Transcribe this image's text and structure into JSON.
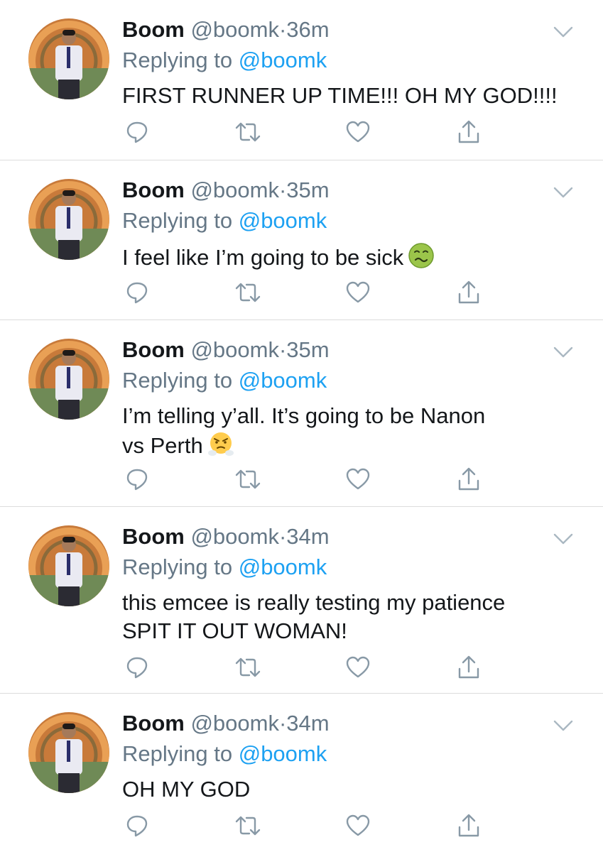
{
  "tweets": [
    {
      "name": "Boom",
      "handle": "@boomk",
      "separator": "·",
      "time": "36m",
      "replying_prefix": "Replying to ",
      "replying_to": "@boomk",
      "line1": "FIRST RUNNER UP TIME!!! OH MY GOD!!!!",
      "line2": "",
      "emoji": ""
    },
    {
      "name": "Boom",
      "handle": "@boomk",
      "separator": "·",
      "time": "35m",
      "replying_prefix": "Replying to ",
      "replying_to": "@boomk",
      "line1": "I feel like I’m going to be sick",
      "line2": "",
      "emoji": "nauseated-face-emoji"
    },
    {
      "name": "Boom",
      "handle": "@boomk",
      "separator": "·",
      "time": "35m",
      "replying_prefix": "Replying to ",
      "replying_to": "@boomk",
      "line1": "I’m telling y’all. It’s going to be Nanon",
      "line2": "vs Perth",
      "emoji": "face-with-steam-from-nose-emoji"
    },
    {
      "name": "Boom",
      "handle": "@boomk",
      "separator": "·",
      "time": "34m",
      "replying_prefix": "Replying to ",
      "replying_to": "@boomk",
      "line1": "this emcee is really testing my patience",
      "line2": "SPIT IT OUT WOMAN!",
      "emoji": ""
    },
    {
      "name": "Boom",
      "handle": "@boomk",
      "separator": "·",
      "time": "34m",
      "replying_prefix": "Replying to ",
      "replying_to": "@boomk",
      "line1": "OH MY GOD",
      "line2": "",
      "emoji": ""
    }
  ],
  "icons": {
    "reply": "reply-icon",
    "retweet": "retweet-icon",
    "like": "like-icon",
    "share": "share-icon",
    "caret": "chevron-down-icon"
  },
  "colors": {
    "text": "#14171a",
    "secondary": "#657786",
    "link": "#1da1f2",
    "icon": "#8899a6",
    "divider": "#dcdcdc"
  }
}
